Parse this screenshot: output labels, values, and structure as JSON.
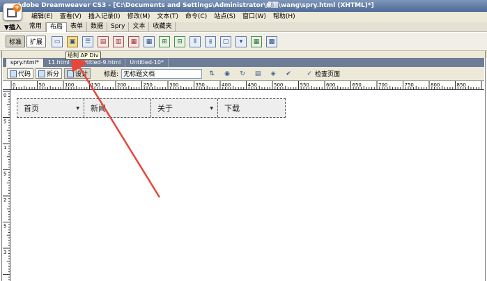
{
  "app": {
    "title": "Adobe Dreamweaver CS3 - [C:\\Documents and Settings\\Administrator\\桌面\\wang\\spry.html (XHTML)*]"
  },
  "menubar": {
    "items": [
      "编辑(E)",
      "查看(V)",
      "插入记录(I)",
      "修改(M)",
      "文本(T)",
      "命令(C)",
      "站点(S)",
      "窗口(W)",
      "帮助(H)"
    ]
  },
  "insertbar": {
    "heading": "▼插入",
    "tabs": [
      "常用",
      "布局",
      "表单",
      "数据",
      "Spry",
      "文本",
      "收藏夹"
    ],
    "active_tab": "布局"
  },
  "layout_toolbar": {
    "mode_buttons": [
      "标准",
      "扩展"
    ],
    "tooltip": "绘制 AP Div"
  },
  "document": {
    "tabs": [
      "spry.html*",
      "11.html",
      "Untitled-9.html",
      "Untitled-10*"
    ],
    "active_tab": "spry.html*",
    "view_buttons": [
      "代码",
      "拆分",
      "设计"
    ],
    "title_label": "标题:",
    "title_value": "无标题文档",
    "check_page_label": "检查页面"
  },
  "ruler": {
    "h_labels": [
      "0",
      "50",
      "100",
      "150",
      "200",
      "250",
      "300",
      "350",
      "400",
      "450",
      "500",
      "550",
      "600",
      "650",
      "700",
      "750",
      "800",
      "850"
    ],
    "v_labels": [
      "0",
      "5",
      "1",
      "5",
      "2",
      "5",
      "3"
    ]
  },
  "spry_menu": {
    "items": [
      {
        "label": "首页",
        "has_submenu": true
      },
      {
        "label": "新闻",
        "has_submenu": false
      },
      {
        "label": "关于",
        "has_submenu": true
      },
      {
        "label": "下载",
        "has_submenu": false
      }
    ]
  },
  "colors": {
    "annotation_arrow": "#e8453c",
    "titlebar": "#5a76a2",
    "doc_tabs": "#6d7d98"
  }
}
